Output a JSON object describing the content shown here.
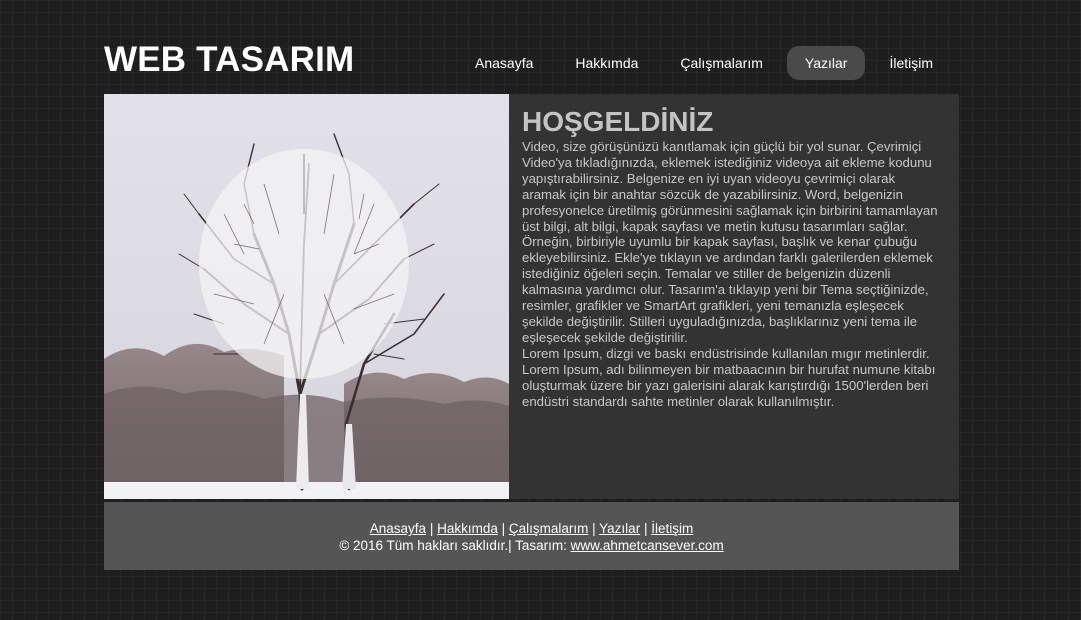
{
  "header": {
    "logo": "WEB TASARIM",
    "nav": [
      {
        "label": "Anasayfa",
        "active": false
      },
      {
        "label": "Hakkımda",
        "active": false
      },
      {
        "label": "Çalışmalarım",
        "active": false
      },
      {
        "label": "Yazılar",
        "active": true
      },
      {
        "label": "İletişim",
        "active": false
      }
    ]
  },
  "main": {
    "title": "HOŞGELDİNİZ",
    "paragraph1": "Video, size görüşünüzü kanıtlamak için güçlü bir yol sunar. Çevrimiçi Video'ya tıkladığınızda, eklemek istediğiniz videoya ait ekleme kodunu yapıştırabilirsiniz. Belgenize en iyi uyan videoyu çevrimiçi olarak aramak için bir anahtar sözcük de yazabilirsiniz. Word, belgenizin profesyonelce üretilmiş görünmesini sağlamak için birbirini tamamlayan üst bilgi, alt bilgi, kapak sayfası ve metin kutusu tasarımları sağlar. Örneğin, birbiriyle uyumlu bir kapak sayfası, başlık ve kenar çubuğu ekleyebilirsiniz. Ekle'ye tıklayın ve ardından farklı galerilerden eklemek istediğiniz öğeleri seçin. Temalar ve stiller de belgenizin düzenli kalmasına yardımcı olur. Tasarım'a tıklayıp yeni bir Tema seçtiğinizde, resimler, grafikler ve SmartArt grafikleri, yeni temanızla eşleşecek şekilde değiştirilir. Stilleri uyguladığınızda, başlıklarınız yeni tema ile eşleşecek şekilde değiştirilir.",
    "paragraph2": "Lorem Ipsum, dizgi ve baskı endüstrisinde kullanılan mıgır metinlerdir. Lorem Ipsum, adı bilinmeyen bir matbaacının bir hurufat numune kitabı oluşturmak üzere bir yazı galerisini alarak karıştırdığı 1500'lerden beri endüstri standardı sahte metinler olarak kullanılmıştır."
  },
  "footer": {
    "links": [
      "Anasayfa",
      "Hakkımda",
      "Çalışmalarım",
      "Yazılar",
      "İletişim"
    ],
    "separator": " | ",
    "copyright": "© 2016 Tüm hakları saklıdır.| Tasarım: ",
    "designer_link": "www.ahmetcansever.com"
  },
  "colors": {
    "background": "#1e1e1e",
    "main_panel": "#333333",
    "footer": "#555555",
    "active_tab": "#4a4a4a"
  }
}
